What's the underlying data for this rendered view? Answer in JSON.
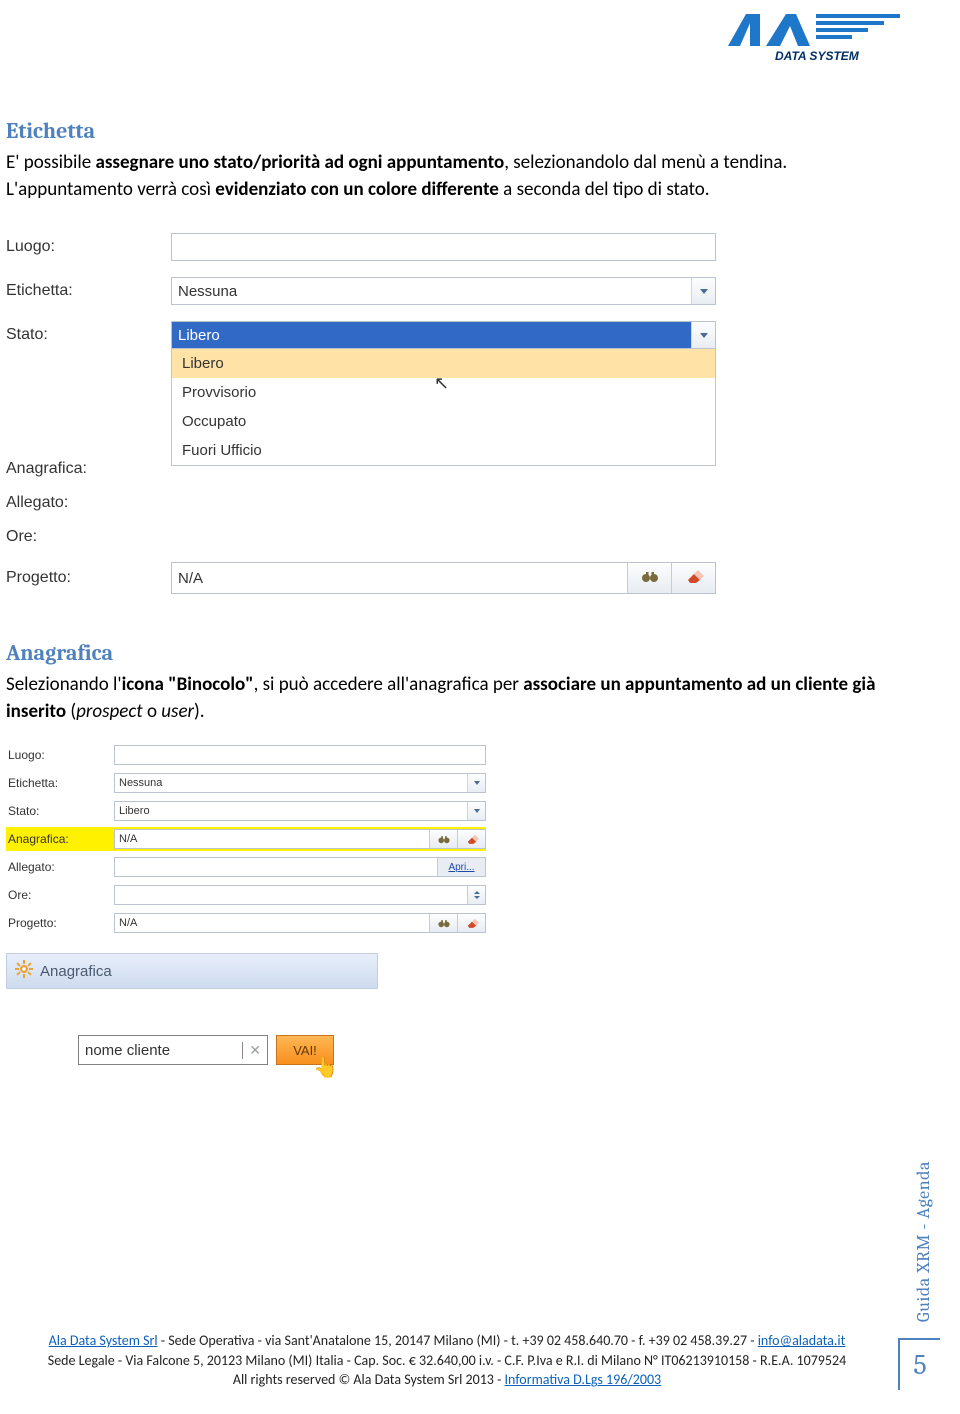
{
  "logo": {
    "line1": "ALA",
    "line2": "DATA SYSTEM"
  },
  "section_etichetta": {
    "heading": "Etichetta",
    "para_txt1": "E' possibile ",
    "para_bold1": "assegnare uno stato/priorità ad ogni appuntamento",
    "para_txt2": ", selezionandolo dal menù a tendina. L'appuntamento verrà così ",
    "para_bold2": "evidenziato con un colore differente",
    "para_txt3": " a seconda del tipo di stato."
  },
  "form1": {
    "labels": {
      "luogo": "Luogo:",
      "etichetta": "Etichetta:",
      "stato": "Stato:",
      "anagrafica": "Anagrafica:",
      "allegato": "Allegato:",
      "ore": "Ore:",
      "progetto": "Progetto:"
    },
    "values": {
      "etichetta": "Nessuna",
      "stato": "Libero",
      "progetto": "N/A"
    },
    "stato_options": [
      "Libero",
      "Provvisorio",
      "Occupato",
      "Fuori Ufficio"
    ]
  },
  "section_anagrafica": {
    "heading": "Anagrafica",
    "para_txt1": "Selezionando l'",
    "para_bold1": "icona \"Binocolo\"",
    "para_txt2": ", si può accedere all'anagrafica per ",
    "para_bold2": "associare un appuntamento ad un cliente già inserito",
    "para_txt3": " (",
    "para_em1": "prospect",
    "para_txt4": " o ",
    "para_em2": "user",
    "para_txt5": ")."
  },
  "form2": {
    "labels": {
      "luogo": "Luogo:",
      "etichetta": "Etichetta:",
      "stato": "Stato:",
      "anagrafica": "Anagrafica:",
      "allegato": "Allegato:",
      "ore": "Ore:",
      "progetto": "Progetto:"
    },
    "values": {
      "etichetta": "Nessuna",
      "stato": "Libero",
      "anagrafica": "N/A",
      "progetto": "N/A"
    },
    "apri_link": "Apri..."
  },
  "anag_panel_title": "Anagrafica",
  "search": {
    "input_value": "nome cliente",
    "button": "VAI!"
  },
  "side_caption": "Guida XRM - Agenda",
  "page_num": "5",
  "footer": {
    "l1_company": "Ala Data System Srl",
    "l1_rest": " - Sede Operativa - via Sant'Anatalone 15, 20147 Milano (MI) - t. +39 02 458.640.70 - f. +39 02 458.39.27 - ",
    "l1_email": "info@aladata.it",
    "l2": "Sede Legale - Via Falcone 5, 20123 Milano (MI) Italia - Cap. Soc. € 32.640,00 i.v. - C.F. P.Iva e R.I. di Milano N° IT06213910158 - R.E.A. 1079524",
    "l3_prefix": "All rights reserved © Ala Data System Srl 2013 - ",
    "l3_link": "Informativa D.Lgs 196/2003"
  }
}
